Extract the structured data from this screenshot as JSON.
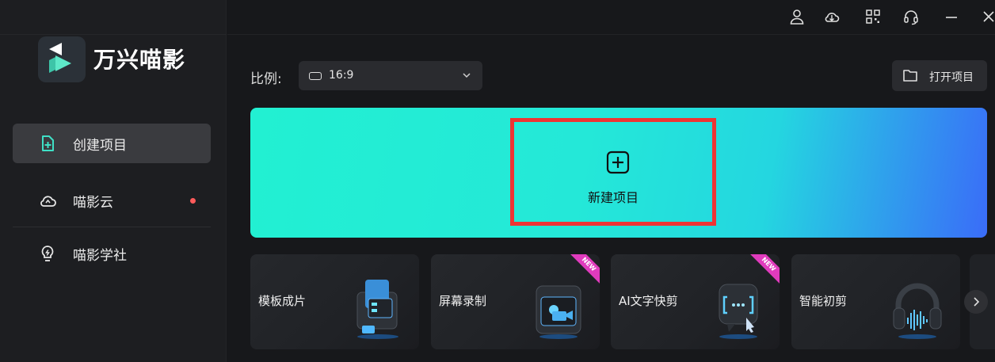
{
  "app": {
    "name": "万兴喵影"
  },
  "sidebar": {
    "items": [
      {
        "label": "创建项目",
        "icon": "add-file-icon"
      },
      {
        "label": "喵影云",
        "icon": "cloud-icon"
      },
      {
        "label": "喵影学社",
        "icon": "lightbulb-icon"
      }
    ]
  },
  "toolbar": {
    "icons": [
      "user-icon",
      "cloud-sync-icon",
      "grid-icon",
      "headset-icon",
      "minimize-icon",
      "close-icon"
    ]
  },
  "ratio": {
    "label": "比例:",
    "value": "16:9"
  },
  "open_project": {
    "label": "打开项目"
  },
  "new_project": {
    "label": "新建项目"
  },
  "cards": [
    {
      "label": "模板成片",
      "badge": ""
    },
    {
      "label": "屏幕录制",
      "badge": "NEW"
    },
    {
      "label": "AI文字快剪",
      "badge": "NEW"
    },
    {
      "label": "智能初剪",
      "badge": ""
    }
  ],
  "colors": {
    "accent_start": "#22f0d2",
    "accent_end": "#3a6cf8",
    "highlight": "#ee3434",
    "notify": "#ff5b5b"
  }
}
